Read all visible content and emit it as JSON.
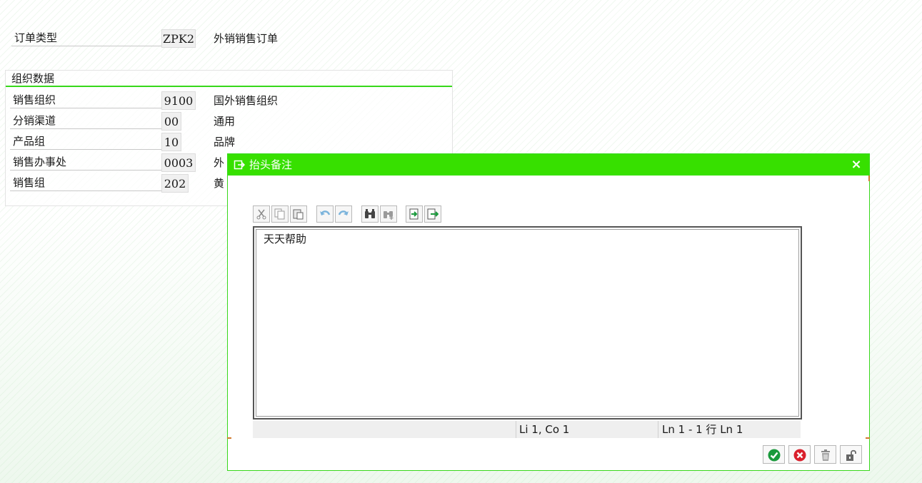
{
  "header": {
    "order_type_label": "订单类型",
    "order_type_code": "ZPK2",
    "order_type_desc": "外销销售订单"
  },
  "org_group": {
    "title": "组织数据",
    "rows": [
      {
        "label": "销售组织",
        "code": "9100",
        "desc": "国外销售组织"
      },
      {
        "label": "分销渠道",
        "code": "00",
        "desc": "通用"
      },
      {
        "label": "产品组",
        "code": "10",
        "desc": "品牌"
      },
      {
        "label": "销售办事处",
        "code": "0003",
        "desc": "外"
      },
      {
        "label": "销售组",
        "code": "202",
        "desc": "黄"
      }
    ]
  },
  "dialog": {
    "title": "抬头备注",
    "close_symbol": "×",
    "toolbar_icons": [
      "cut-icon",
      "copy-icon",
      "paste-icon",
      "undo-icon",
      "redo-icon",
      "find-icon",
      "find-next-icon",
      "import-icon",
      "export-icon"
    ],
    "editor_text": "天天帮助",
    "status": {
      "position": "Li 1, Co 1",
      "lines": "Ln 1 - 1 行 Ln 1"
    },
    "buttons": [
      "confirm-icon",
      "cancel-icon",
      "delete-icon",
      "unlock-icon"
    ]
  },
  "colors": {
    "accent_green": "#37e000",
    "confirm_green": "#1a9a3c",
    "cancel_red": "#d9202c"
  }
}
